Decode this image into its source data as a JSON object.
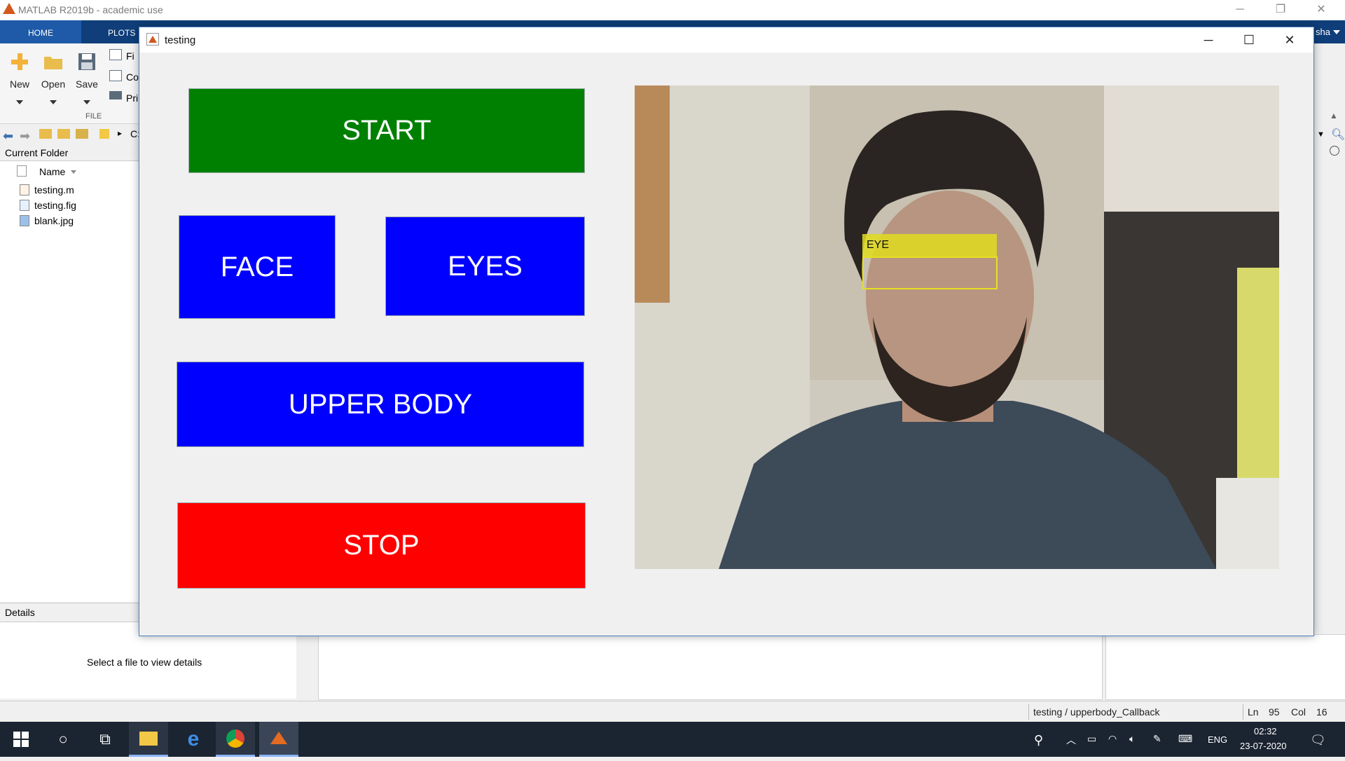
{
  "app": {
    "title": "MATLAB R2019b - academic use",
    "tabs": [
      "HOME",
      "PLOTS"
    ],
    "user_label": "sha",
    "file_buttons": [
      "New",
      "Open",
      "Save"
    ],
    "file_partial_items": [
      "Fi",
      "Co",
      "Pri"
    ],
    "section_label": "FILE",
    "address_partial": "C:"
  },
  "current_folder": {
    "header": "Current Folder",
    "column": "Name",
    "files": [
      "testing.m",
      "testing.fig",
      "blank.jpg"
    ]
  },
  "details": {
    "header": "Details",
    "message": "Select a file to view details"
  },
  "figure": {
    "title": "testing",
    "buttons": {
      "start": "START",
      "face": "FACE",
      "eyes": "EYES",
      "upper_body": "UPPER BODY",
      "stop": "STOP"
    },
    "colors": {
      "start": "#008000",
      "face": "#0000ff",
      "eyes": "#0000ff",
      "upper_body": "#0000ff",
      "stop": "#ff0000",
      "detection_box": "#e6e020"
    },
    "detection_label": "EYE"
  },
  "status": {
    "callback": "testing / upperbody_Callback",
    "ln_label": "Ln",
    "ln_value": "95",
    "col_label": "Col",
    "col_value": "16"
  },
  "taskbar": {
    "language": "ENG",
    "time": "02:32",
    "date": "23-07-2020"
  }
}
